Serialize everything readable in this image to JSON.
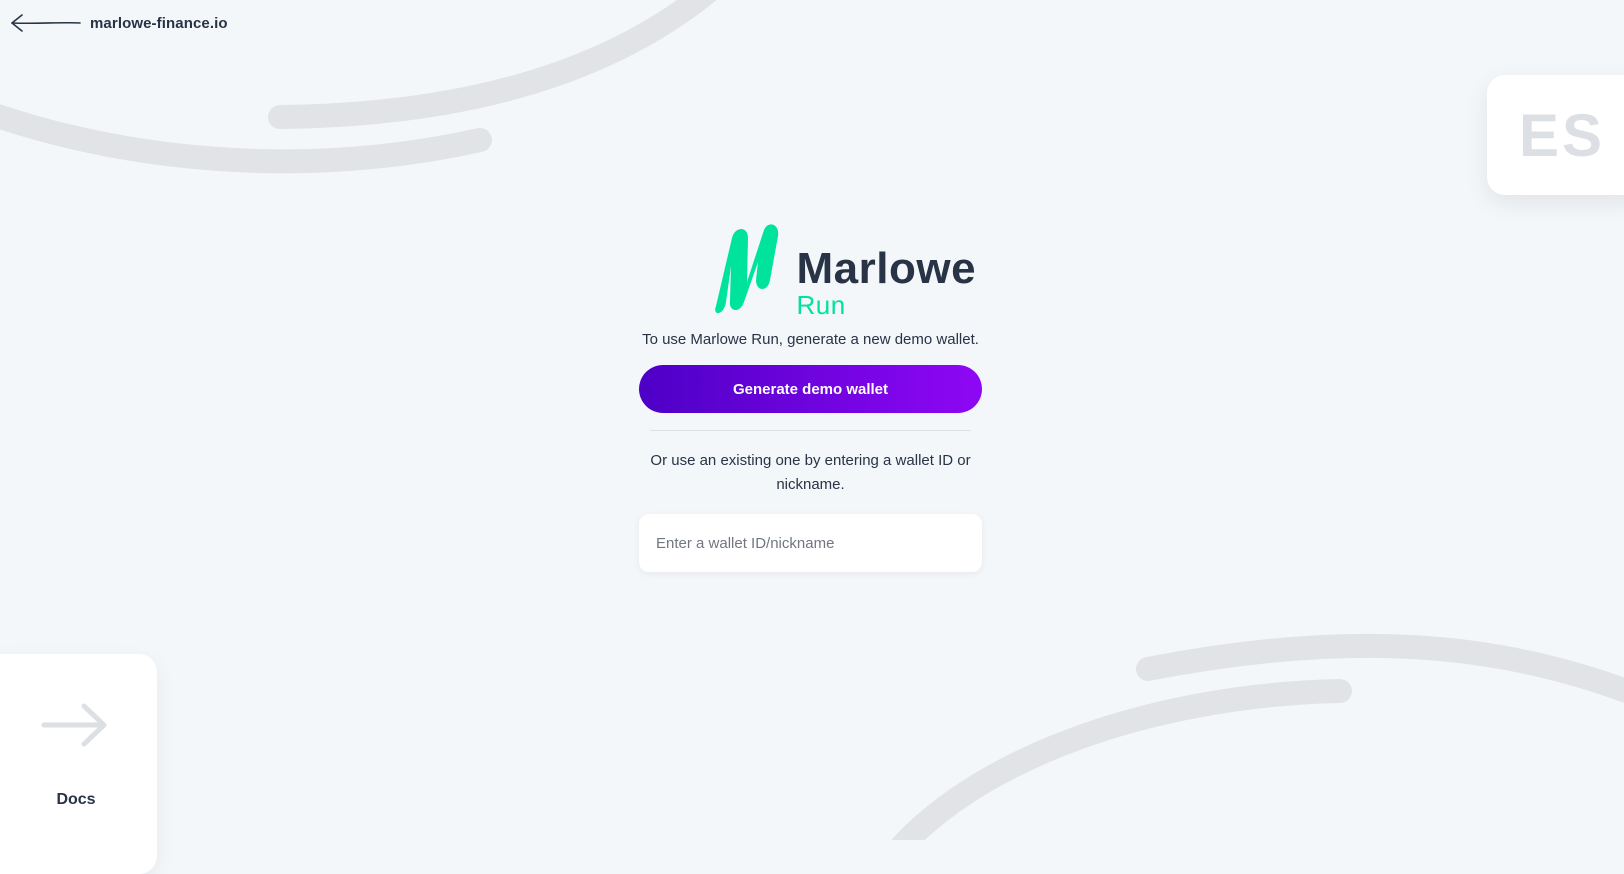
{
  "header": {
    "back_link_label": "marlowe-finance.io",
    "back_icon": "arrow-left-icon"
  },
  "language_switch": {
    "label": "ES"
  },
  "logo": {
    "brand": "Marlowe",
    "product": "Run",
    "mark_icon": "marlowe-m-logo-icon",
    "colors": {
      "accent": "#00e39c",
      "text": "#283346"
    }
  },
  "main": {
    "intro_text": "To use Marlowe Run, generate a new demo wallet.",
    "generate_button_label": "Generate demo wallet",
    "alternative_text": "Or use an existing one by entering a wallet ID or nickname.",
    "wallet_input": {
      "value": "",
      "placeholder": "Enter a wallet ID/nickname"
    }
  },
  "docs_card": {
    "label": "Docs",
    "icon": "arrow-right-icon"
  },
  "colors": {
    "background": "#f4f7fa",
    "button_gradient_start": "#4d00c6",
    "button_gradient_end": "#8f07f5",
    "curve": "#e1e3e6"
  }
}
